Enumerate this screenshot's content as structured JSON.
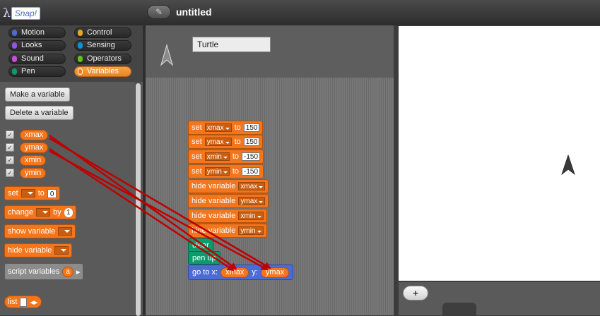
{
  "app": {
    "logo_text": "Snap!",
    "logo_lambda": "λ",
    "project_title": "untitled",
    "edit_icon": "✎"
  },
  "categories": [
    {
      "label": "Motion",
      "color": "#4a6cd4"
    },
    {
      "label": "Control",
      "color": "#e6a822"
    },
    {
      "label": "Looks",
      "color": "#8f56e3"
    },
    {
      "label": "Sensing",
      "color": "#0494dc"
    },
    {
      "label": "Sound",
      "color": "#cf4ad9"
    },
    {
      "label": "Operators",
      "color": "#62c213"
    },
    {
      "label": "Pen",
      "color": "#0e9a6c"
    },
    {
      "label": "Variables",
      "color": "#f3761d"
    }
  ],
  "selected_category": "Variables",
  "palette": {
    "make_variable": "Make a variable",
    "delete_variable": "Delete a variable",
    "variables": [
      {
        "name": "xmax",
        "checked": true
      },
      {
        "name": "ymax",
        "checked": true
      },
      {
        "name": "xmin",
        "checked": true
      },
      {
        "name": "ymin",
        "checked": true
      }
    ],
    "checkmark": "✓",
    "set_block": {
      "label": "set",
      "to": "to",
      "value": "0"
    },
    "change_block": {
      "label": "change",
      "by": "by",
      "value": "1"
    },
    "show_block": "show variable",
    "hide_block": "hide variable",
    "script_vars": {
      "label": "script variables",
      "var": "a",
      "arrow": "▸"
    },
    "list_block": {
      "label": "list",
      "arrows": "◂▸"
    }
  },
  "sprite": {
    "name": "Turtle"
  },
  "script": {
    "set_blocks": [
      {
        "label": "set",
        "var": "xmax",
        "to": "to",
        "value": "150"
      },
      {
        "label": "set",
        "var": "ymax",
        "to": "to",
        "value": "150"
      },
      {
        "label": "set",
        "var": "xmin",
        "to": "to",
        "value": "-150"
      },
      {
        "label": "set",
        "var": "ymin",
        "to": "to",
        "value": "-150"
      }
    ],
    "hide_blocks": [
      {
        "label": "hide variable",
        "var": "xmax"
      },
      {
        "label": "hide variable",
        "var": "ymax"
      },
      {
        "label": "hide variable",
        "var": "xmin"
      },
      {
        "label": "hide variable",
        "var": "ymin"
      }
    ],
    "clear": "clear",
    "pen_up": "pen up",
    "goto": {
      "label": "go to x:",
      "x": "xmax",
      "y_label": "y:",
      "y": "ymax"
    }
  },
  "stage": {
    "add_sprite_icon": "+"
  },
  "colors": {
    "variables": "#f3761d",
    "pen": "#0e9a6c",
    "motion": "#4a6cd4",
    "annotation_arrow": "#c00000"
  }
}
